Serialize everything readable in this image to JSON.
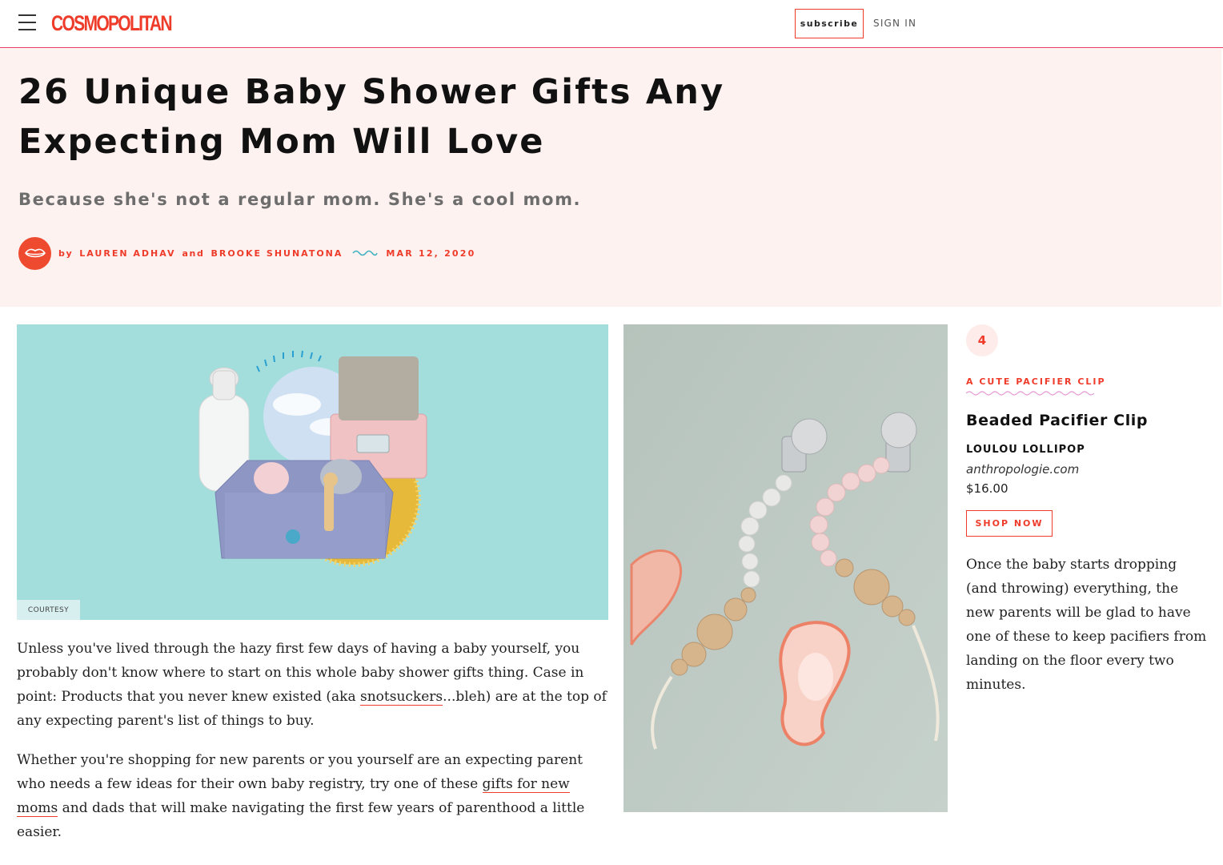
{
  "nav": {
    "logo": "COSMOPOLITAN",
    "subscribe_label": "subscribe",
    "signin_label": "SIGN IN"
  },
  "article": {
    "title": "26 Unique Baby Shower Gifts Any Expecting Mom Will Love",
    "dek": "Because she's not a regular mom. She's a cool mom.",
    "byline": {
      "by": "by",
      "author1": "LAUREN ADHAV",
      "and": "and",
      "author2": "BROOKE SHUNATONA",
      "date": "MAR 12, 2020"
    },
    "lead_image_credit": "COURTESY",
    "paragraph1": {
      "before_link": "Unless you've lived through the hazy first few days of having a baby yourself, you probably don't know where to start on this whole baby shower gifts thing. Case in point: Products that you never knew existed (aka ",
      "link": "snotsuckers",
      "after_link": "...bleh) are at the top of any expecting parent's list of things to buy."
    },
    "paragraph2": {
      "before_link": "Whether you're shopping for new parents or you yourself are an expecting parent who needs a few ideas for their own baby registry, try one of these ",
      "link": "gifts for new moms",
      "after_link": " and dads that will make navigating the first few years of parenthood a little easier."
    }
  },
  "product": {
    "number": "4",
    "kicker": "A CUTE PACIFIER CLIP",
    "name": "Beaded Pacifier Clip",
    "brand": "LOULOU LOLLIPOP",
    "retailer": "anthropologie.com",
    "price": "$16.00",
    "shop_label": "SHOP NOW",
    "description": "Once the baby starts dropping (and throwing) everything, the new parents will be glad to have one of these to keep pacifiers from landing on the floor every two minutes."
  },
  "icons": [
    "hamburger-icon",
    "lips-icon",
    "wave-divider-icon"
  ],
  "colors": {
    "brand_red": "#ee3b2a",
    "hero_bg": "#fdf2f0",
    "lead_bg": "#a3dedd",
    "nav_rule": "#e8365d"
  }
}
